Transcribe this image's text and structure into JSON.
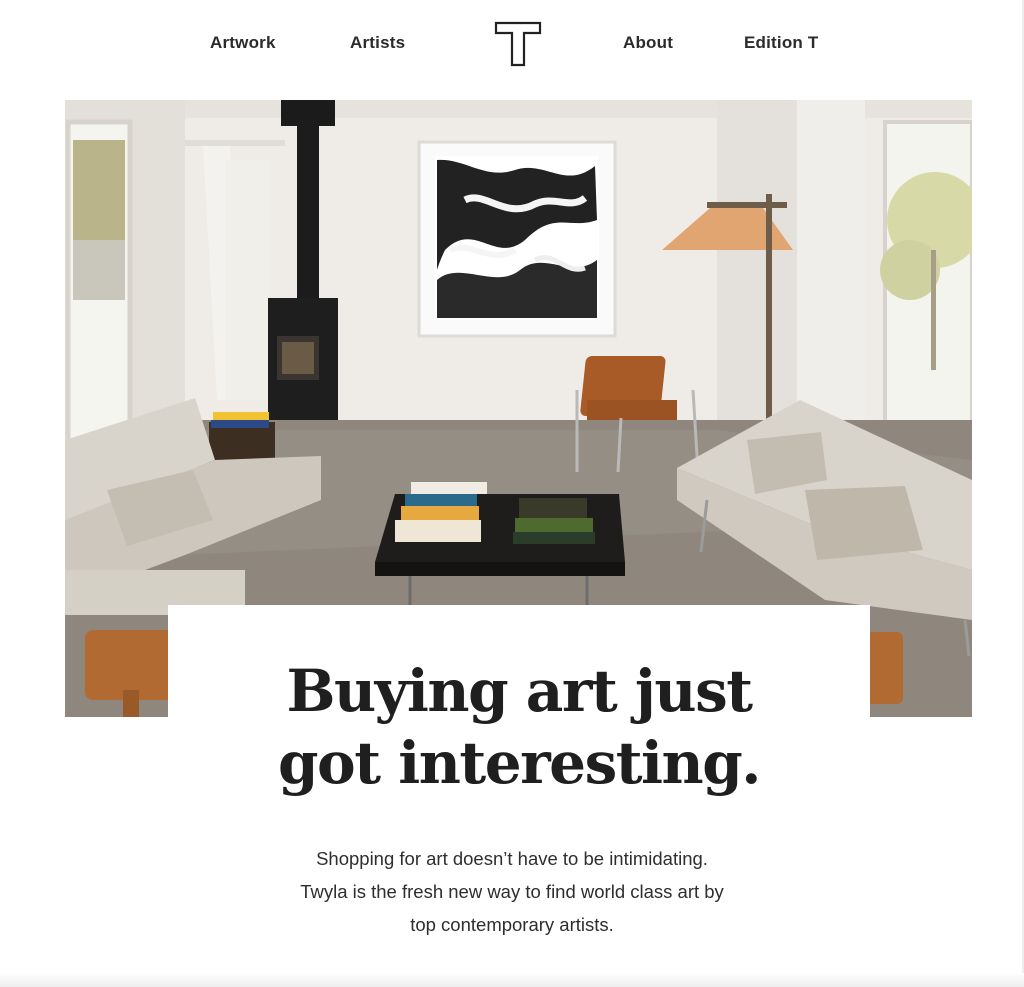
{
  "nav": {
    "items": [
      {
        "label": "Artwork"
      },
      {
        "label": "Artists"
      },
      {
        "label": "About"
      },
      {
        "label": "Edition T"
      }
    ],
    "logo_icon": "twyla-t-logo-icon"
  },
  "hero": {
    "image_description_icon": "living-room-photo"
  },
  "headline": {
    "line1": "Buying art just",
    "line2": "got interesting."
  },
  "subtext": {
    "line1": "Shopping for art doesn’t have to be intimidating.",
    "line2": "Twyla is the fresh new way to find world class art by",
    "line3": "top contemporary artists."
  },
  "colors": {
    "text": "#262626",
    "background": "#ffffff",
    "wall": "#ece9e4",
    "floor": "#8e857b",
    "sofa": "#d8d3ca"
  }
}
